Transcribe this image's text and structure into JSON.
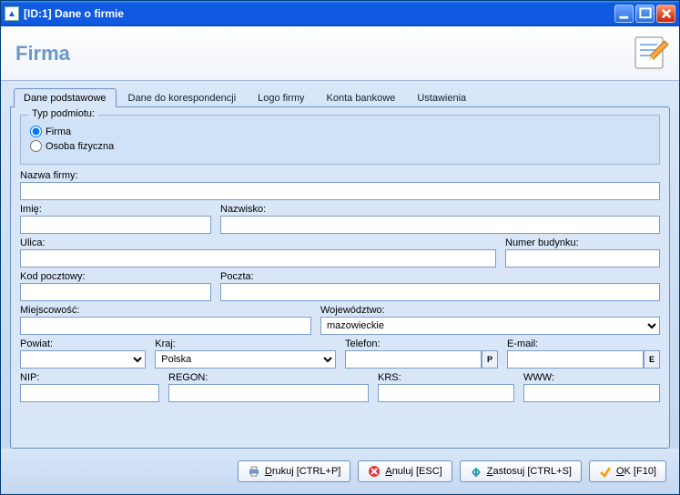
{
  "window": {
    "title": "[ID:1] Dane o firmie"
  },
  "header": {
    "title": "Firma"
  },
  "tabs": [
    {
      "label": "Dane podstawowe",
      "active": true
    },
    {
      "label": "Dane do korespondencji",
      "active": false
    },
    {
      "label": "Logo firmy",
      "active": false
    },
    {
      "label": "Konta bankowe",
      "active": false
    },
    {
      "label": "Ustawienia",
      "active": false
    }
  ],
  "group": {
    "legend": "Typ podmiotu:",
    "radios": {
      "firma": "Firma",
      "osoba": "Osoba fizyczna",
      "selected": "firma"
    }
  },
  "labels": {
    "nazwa_firmy": "Nazwa firmy:",
    "imie": "Imię:",
    "nazwisko": "Nazwisko:",
    "ulica": "Ulica:",
    "numer_budynku": "Numer budynku:",
    "kod_pocztowy": "Kod pocztowy:",
    "poczta": "Poczta:",
    "miejscowosc": "Miejscowość:",
    "wojewodztwo": "Województwo:",
    "powiat": "Powiat:",
    "kraj": "Kraj:",
    "telefon": "Telefon:",
    "email": "E-mail:",
    "nip": "NIP:",
    "regon": "REGON:",
    "krs": "KRS:",
    "www": "WWW:"
  },
  "values": {
    "nazwa_firmy": "",
    "imie": "",
    "nazwisko": "",
    "ulica": "",
    "numer_budynku": "",
    "kod_pocztowy": "",
    "poczta": "",
    "miejscowosc": "",
    "wojewodztwo": "mazowieckie",
    "powiat": "",
    "kraj": "Polska",
    "telefon": "",
    "email": "",
    "nip": "",
    "regon": "",
    "krs": "",
    "www": ""
  },
  "mini": {
    "phone_btn": "P",
    "email_btn": "E"
  },
  "buttons": {
    "print": {
      "before": "",
      "under": "D",
      "after": "rukuj [CTRL+P]"
    },
    "cancel": {
      "before": "",
      "under": "A",
      "after": "nuluj [ESC]"
    },
    "apply": {
      "before": "",
      "under": "Z",
      "after": "astosuj [CTRL+S]"
    },
    "ok": {
      "before": "",
      "under": "O",
      "after": "K [F10]"
    }
  }
}
